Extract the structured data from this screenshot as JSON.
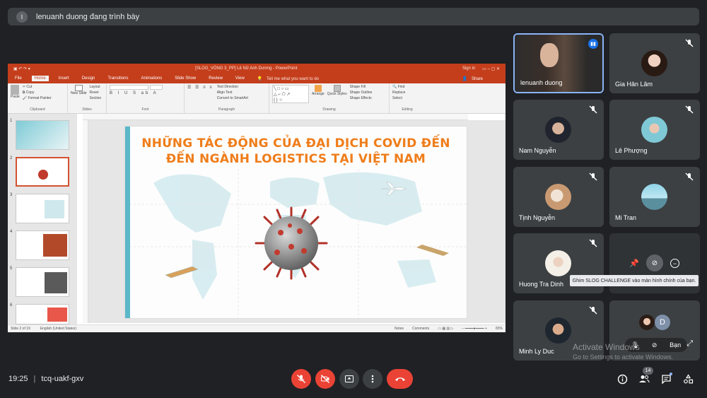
{
  "banner": {
    "avatar_letter": "l",
    "text": "lenuanh duong đang trình bày"
  },
  "ppt": {
    "window_title": "[SLOG_VÒNG 3_PP] Lê Nữ Anh Dương - PowerPoint",
    "sign_in": "Sign in",
    "tabs": [
      "File",
      "Home",
      "Insert",
      "Design",
      "Transitions",
      "Animations",
      "Slide Show",
      "Review",
      "View"
    ],
    "tell_me": "Tell me what you want to do",
    "share": "Share",
    "ribbon": {
      "clipboard": {
        "label": "Clipboard",
        "paste": "Paste",
        "cut": "Cut",
        "copy": "Copy",
        "format_painter": "Format Painter"
      },
      "slides": {
        "label": "Slides",
        "new_slide": "New Slide",
        "layout": "Layout",
        "reset": "Reset",
        "section": "Section"
      },
      "font": {
        "label": "Font"
      },
      "paragraph": {
        "label": "Paragraph",
        "text_direction": "Text Direction",
        "align_text": "Align Text",
        "convert_smartart": "Convert to SmartArt"
      },
      "drawing": {
        "label": "Drawing",
        "arrange": "Arrange",
        "quick_styles": "Quick Styles",
        "shape_fill": "Shape Fill",
        "shape_outline": "Shape Outline",
        "shape_effects": "Shape Effects"
      },
      "editing": {
        "label": "Editing",
        "find": "Find",
        "replace": "Replace",
        "select": "Select"
      }
    },
    "thumb_numbers": [
      "1",
      "2",
      "3",
      "4",
      "5",
      "6"
    ],
    "slide": {
      "title_line1": "NHỮNG TÁC ĐỘNG CỦA ĐẠI DỊCH COVID ĐẾN",
      "title_line2": "ĐẾN NGÀNH LOGISTICS TẠI VIỆT NAM"
    },
    "status": {
      "slide_of": "Slide 2 of 19",
      "language": "English (United States)",
      "notes": "Notes",
      "comments": "Comments",
      "zoom": "83%"
    }
  },
  "participants": [
    {
      "name": "lenuanh duong",
      "presenting": true
    },
    {
      "name": "Gia Hân Lâm"
    },
    {
      "name": "Nam Nguyễn"
    },
    {
      "name": "Lê Phượng"
    },
    {
      "name": "Tịnh Nguyễn"
    },
    {
      "name": "Mi Tran"
    },
    {
      "name": "Huong Tra Dinh"
    },
    {
      "name": "Minh Ly Duc"
    }
  ],
  "self_tile": {
    "avatar_letter": "D",
    "label": "Bạn"
  },
  "tooltip": "Ghim SLOG CHALLENGE vào màn hình chính của bạn.",
  "bottom": {
    "time": "19:25",
    "separator": "|",
    "meeting_code": "tcq-uakf-gxv",
    "participants_count": "14"
  },
  "watermark": {
    "line1": "Activate Windows",
    "line2": "Go to Settings to activate Windows."
  },
  "colors": {
    "meet_bg": "#202124",
    "tile_bg": "#3c4043",
    "ppt_accent": "#c43e1c",
    "end_call": "#ea4335",
    "slide_title": "#ef7d1a"
  }
}
